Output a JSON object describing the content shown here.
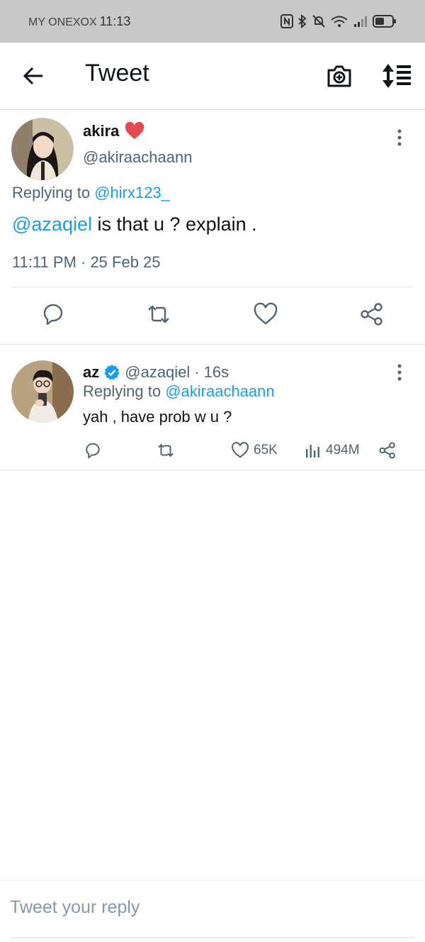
{
  "status_bar": {
    "carrier": "MY ONEXOX",
    "time": "11:13",
    "icons": [
      "nfc-icon",
      "bluetooth-icon",
      "silent-bell-icon",
      "wifi-icon",
      "signal-icon",
      "battery-icon"
    ]
  },
  "header": {
    "title": "Tweet",
    "icons": [
      "back-arrow-icon",
      "camera-add-icon",
      "sort-icon"
    ]
  },
  "main_tweet": {
    "display_name": "akira",
    "name_emoji": "❤️",
    "handle": "@akiraachaann",
    "replying_prefix": "Replying to ",
    "replying_handle": "@hirx123_",
    "mention": "@azaqiel",
    "text": " is that u ? explain .",
    "meta": "11:11 PM · 25 Feb 25",
    "actions": [
      "reply-icon",
      "retweet-icon",
      "like-icon",
      "share-icon"
    ]
  },
  "reply_tweet": {
    "display_name": "az",
    "verified": true,
    "handle": "@azaqiel",
    "separator": "·",
    "age": "16s",
    "replying_prefix": "Replying to ",
    "replying_handle": "@akiraachaann",
    "text": "yah , have prob w u ?",
    "likes": "65K",
    "views": "494M"
  },
  "reply_bar": {
    "placeholder": "Tweet your reply"
  },
  "colors": {
    "accent": "#1d9bf0",
    "secondary_text": "#536471",
    "heart": "#e0245e",
    "status_bar_bg": "#c8c8c8"
  }
}
